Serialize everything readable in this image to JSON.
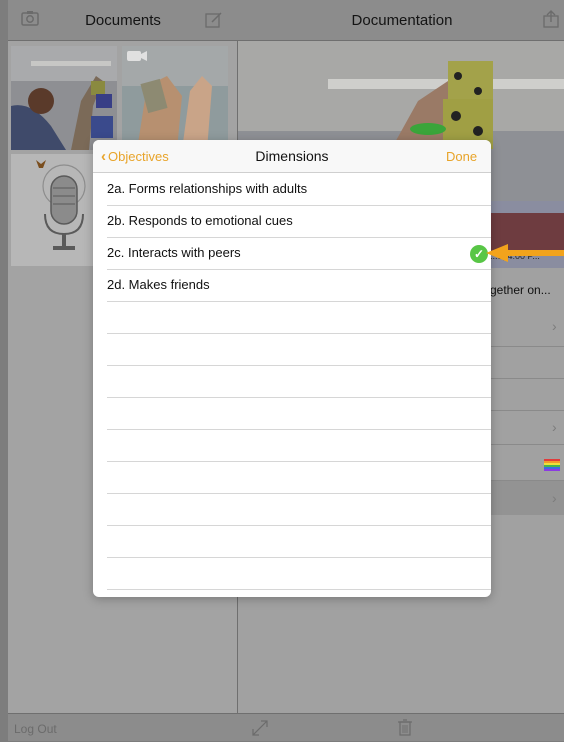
{
  "left_panel": {
    "title": "Documents",
    "logout_label": "Log Out"
  },
  "right_panel": {
    "title": "Documentation",
    "peek_date": "...8, 4:00 P...",
    "peek_text": "gether on..."
  },
  "modal": {
    "back_label": "Objectives",
    "title": "Dimensions",
    "done_label": "Done",
    "items": [
      {
        "label": "2a. Forms relationships with adults",
        "checked": false
      },
      {
        "label": "2b. Responds to emotional cues",
        "checked": false
      },
      {
        "label": "2c. Interacts with peers",
        "checked": true
      },
      {
        "label": "2d. Makes friends",
        "checked": false
      }
    ]
  },
  "colors": {
    "accent": "#e8a42a",
    "check": "#58c646",
    "arrow": "#f2a31c"
  },
  "icons": [
    "camera-icon",
    "compose-icon",
    "share-icon",
    "expand-icon",
    "trash-icon",
    "chevron-left-icon",
    "checkmark-icon",
    "microphone-icon"
  ]
}
